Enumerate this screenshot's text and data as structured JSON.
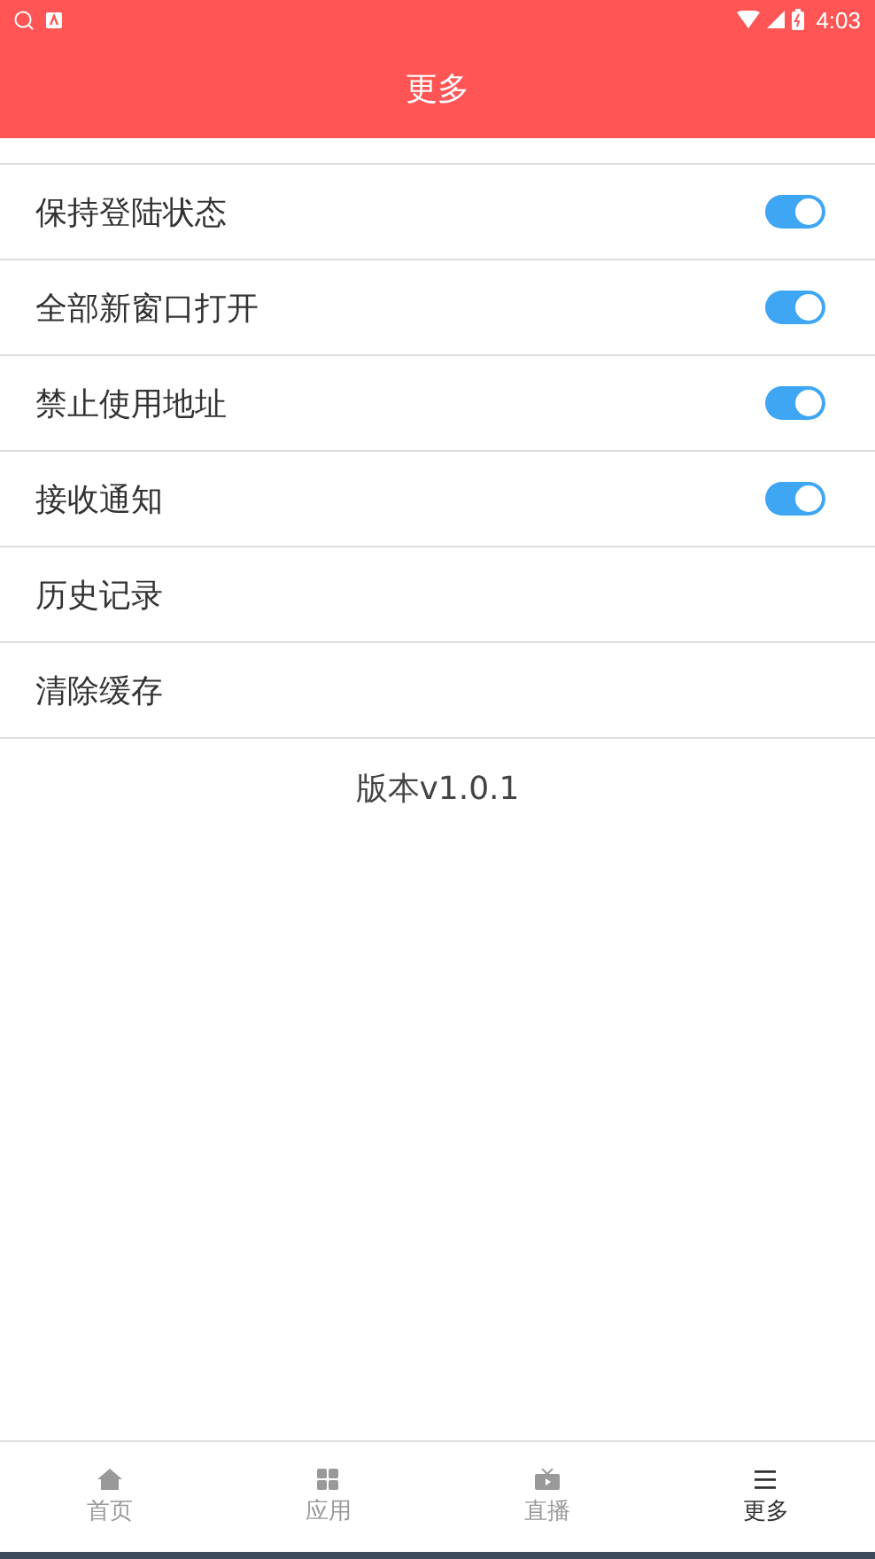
{
  "status_bar": {
    "time": "4:03"
  },
  "header": {
    "title": "更多"
  },
  "settings": [
    {
      "kind": "toggle",
      "label": "保持登陆状态",
      "on": true
    },
    {
      "kind": "toggle",
      "label": "全部新窗口打开",
      "on": true
    },
    {
      "kind": "toggle",
      "label": "禁止使用地址",
      "on": true
    },
    {
      "kind": "toggle",
      "label": "接收通知",
      "on": true
    },
    {
      "kind": "link",
      "label": "历史记录"
    },
    {
      "kind": "link",
      "label": "清除缓存"
    }
  ],
  "version": "版本v1.0.1",
  "tab_bar": [
    {
      "kind": "home",
      "label": "首页",
      "selected": false
    },
    {
      "kind": "grid",
      "label": "应用",
      "selected": false
    },
    {
      "kind": "tv",
      "label": "直播",
      "selected": false
    },
    {
      "kind": "menu",
      "label": "更多",
      "selected": true
    }
  ]
}
